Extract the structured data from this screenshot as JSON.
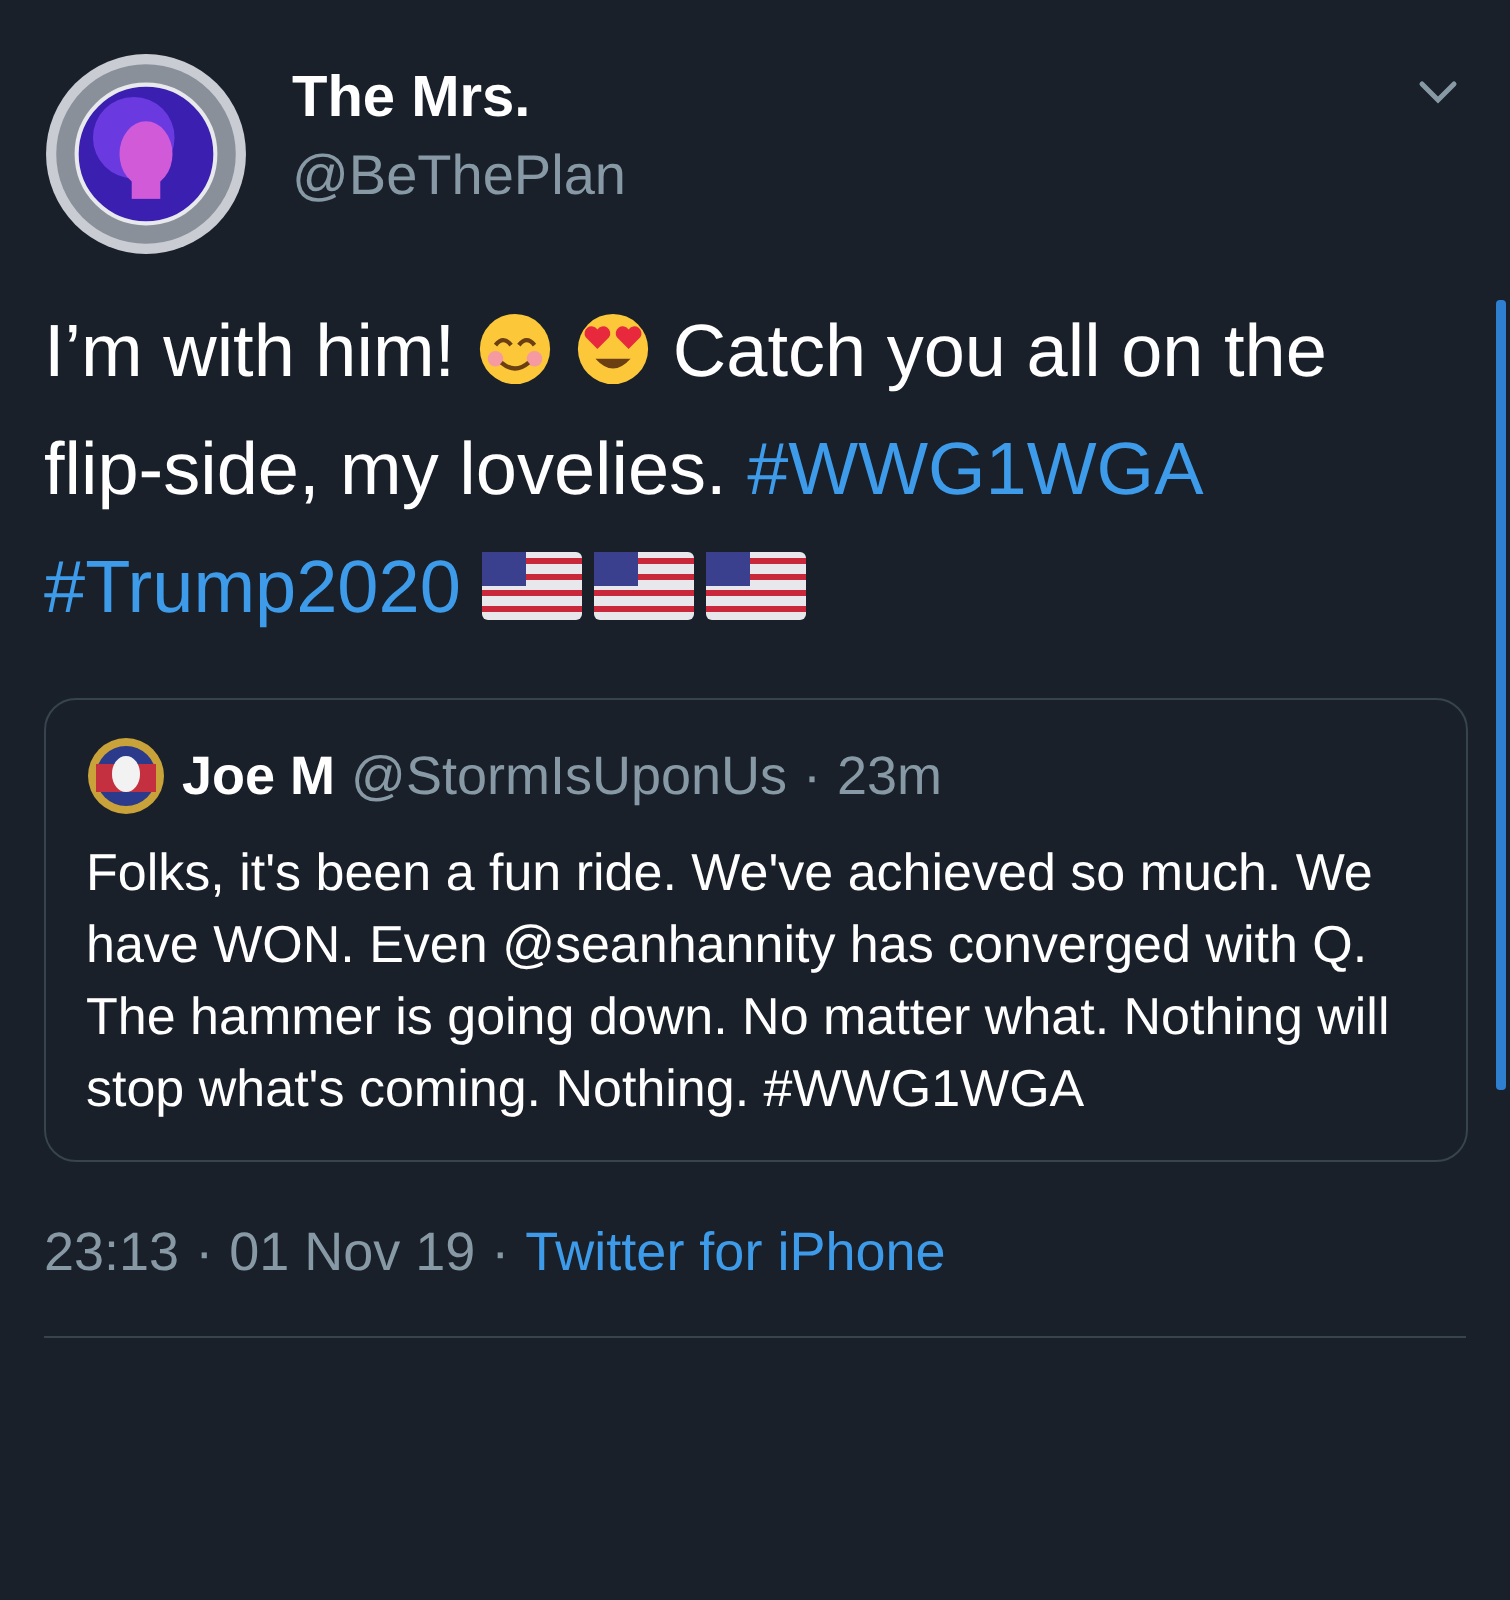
{
  "author": {
    "name": "The Mrs.",
    "handle": "@BeThePlan"
  },
  "tweet": [
    {
      "kind": "text",
      "text": "I’m with him!"
    },
    {
      "kind": "smiling-face"
    },
    {
      "kind": "heart-eyes"
    },
    {
      "kind": "text",
      "text": "Catch you all on the flip-side, my lovelies."
    },
    {
      "kind": "hashtag",
      "text": "#WWG1WGA"
    },
    {
      "kind": "hashtag",
      "text": "#Trump2020"
    },
    {
      "kind": "flag"
    },
    {
      "kind": "flag"
    },
    {
      "kind": "flag"
    }
  ],
  "quote": {
    "name": "Joe M",
    "handle": "@StormIsUponUs",
    "separator": "·",
    "time": "23m",
    "text": "Folks, it's been a fun ride. We've achieved so much. We have WON. Even @seanhannity has converged with Q. The hammer is going down. No matter what. Nothing will stop what's coming. Nothing. #WWG1WGA"
  },
  "footer": {
    "time": "23:13",
    "sep1": "·",
    "date": "01 Nov 19",
    "sep2": "·",
    "source": "Twitter for iPhone"
  }
}
